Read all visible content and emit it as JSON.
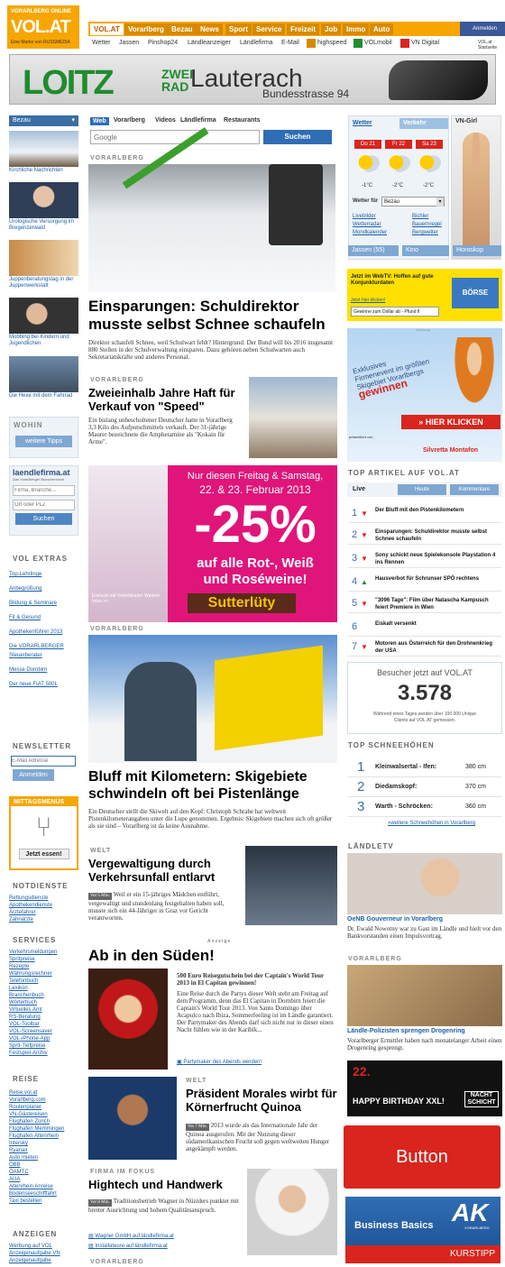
{
  "header": {
    "logo_top": "VORARLBERG ONLINE",
    "logo_main": "VOL.AT",
    "logo_sub": "Eine Marke von RUSSMEDIA",
    "tabs": [
      "VOL.AT",
      "Vorarlberg",
      "Bezau",
      "News",
      "Sport",
      "Service",
      "Freizeit",
      "Job",
      "Immo",
      "Auto"
    ],
    "facebook": "Anmelden",
    "subnav": [
      "Wetter",
      "Jassen",
      "Pinshop24",
      "Ländleanzeiger",
      "Ländlefirma",
      "E-Mail",
      "highspeed",
      "VOLmobil",
      "VN Digital",
      "VOL.at Startseite"
    ]
  },
  "banner": {
    "brand": "LOITZ",
    "brand2": "ZWEI RAD",
    "city": "Lauterach",
    "street": "Bundesstrasse 94"
  },
  "left": {
    "region_select": "Bezau",
    "thumbs": [
      "Kirchliche Nachrichten",
      "Urologische Versorgung im Bregenzerwald",
      "Juppenberatungstag in der Juppenwerkstatt",
      "Mobbing bei Kindern und Jugendlichen",
      "Die Hexe mit dem Fahrrad"
    ],
    "wohin": {
      "title": "WOHIN",
      "button": "weitere Tipps"
    },
    "laendlefirma": {
      "title": "laendlefirma.at",
      "subtitle": "Das Vorarlberger Branchenbuch",
      "firma_ph": "Firma, Branche...",
      "ort_ph": "Ort oder PLZ",
      "button": "Suchen"
    },
    "extras_title": "VOL EXTRAS",
    "extras": [
      "Top-Lehrlinge",
      "Anbegrüßung",
      "Bildung & Seminare",
      "Fit & Gesund",
      "Apothekenführer 2013",
      "Die VORARLBERGER Steuerberater",
      "Messe Dornbirn",
      "Der neue FIAT 500L"
    ],
    "newsletter": {
      "title": "NEWSLETTER",
      "placeholder": "E-Mail Adresse",
      "button": "Anmelden"
    },
    "mittag": {
      "title": "MITTAGSMENÜS",
      "button": "Jetzt essen!"
    },
    "notdienste_title": "NOTDIENSTE",
    "notdienste": [
      "Rettungsdienste",
      "Apothekendienste",
      "Ärztefahrer",
      "Zahnärzte"
    ],
    "services_title": "SERVICES",
    "services": [
      "Verkehrsmeldungen",
      "Spritpreise",
      "Rezepte",
      "Währungsrechner",
      "Telefonbuch",
      "Lexikon",
      "Branchenbuch",
      "Wörterbuch",
      "Virtuelles Amt",
      "RS-Beratung",
      "VOL-Toolbar",
      "VOL-Screensaver",
      "VOL-iPhone-App",
      "Sprit-Tiefpreise",
      "Festspiel-Archiv"
    ],
    "reise_title": "REISE",
    "reise": [
      "Reise.vol.at",
      "Vorarlberg.com",
      "Routenplaner",
      "VN-Gästereisen",
      "Flughafen Zürich",
      "Flughafen Memmingen",
      "Flughafen Altenrhein",
      "Intersky",
      "Ryanair",
      "Auto mieten",
      "ÖBB",
      "ÖAMTC",
      "AUA",
      "Altenrhein Anreise",
      "Bodenseeschifffahrt",
      "Taxi bestellen"
    ],
    "anzeigen_title": "ANZEIGEN",
    "anzeigen": [
      "Werbung auf VOL",
      "Anzeigenaufgabe VN",
      "Anzeigenaufgabe"
    ]
  },
  "middle": {
    "search_tabs": [
      "Web",
      "Vorarlberg",
      "Videos",
      "Ländlefirma",
      "Restaurants"
    ],
    "search_placeholder": "Google",
    "search_button": "Suchen",
    "a1": {
      "kicker": "VORARLBERG",
      "title": "Einsparungen: Schuldirektor musste selbst Schnee schaufeln",
      "body": "Direktor schaufelt Schnee, weil Schulwart fehlt? Hintergrund: Der Bund will bis 2016 insgesamt 880 Stellen in der Schulverwaltung einsparen. Dazu gehören neben Schulwarten auch Sekretariatskräfte und anderes Personal."
    },
    "a2": {
      "kicker": "VORARLBERG",
      "title": "Zweieinhalb Jahre Haft für Verkauf von \"Speed\"",
      "body": "Ein bislang unbescholtener Deutscher hatte in Vorarlberg 3,3 Kilo des Aufputschmittels verkauft. Der 31-jährige Maurer bezeichnete die Amphetamine als \"Kokain für Arme\"."
    },
    "ad": {
      "line1": "Nur diesen Freitag & Samstag,",
      "line2": "22. & 23. Februar 2013",
      "pct": "-25%",
      "line3": "auf alle Rot-, Weiß",
      "line4": "und Roséweine!",
      "brand": "Sutterlüty",
      "small": "Exklusiv mit Vorteilskarte! Weitere Infos >>"
    },
    "a3": {
      "kicker": "VORARLBERG",
      "title": "Bluff mit Kilometern: Skigebiete schwindeln oft bei Pistenlänge",
      "body": "Ein Deutscher stellt die Skiwelt auf den Kopf: Christoph Schrahe hat weltweit Pistenkilometerangaben unter die Lupe genommen. Ergebnis: Skigebiete machen sich oft größer als sie sind – Vorarlberg ist da keine Ausnahme."
    },
    "a4": {
      "kicker": "WELT",
      "title": "Vergewaltigung durch Verkehrsunfall entlarvt",
      "badge": "Vor 5 Min.",
      "body": "Weil er ein 15-jähriges Mädchen entführt, vergewaltigt und stundenlang festgehalten haben soll, musste sich ein 44-Jähriger in Graz vor Gericht verantworten."
    },
    "a5": {
      "kicker": "Anzeige",
      "title": "Ab in den Süden!",
      "subtitle": "500 Euro Reisegutschein bei der Captain's World Tour 2013 in El Capitan gewinnen!",
      "body": "Eine Reise durch die Partys dieser Welt steht am Freitag auf dem Programm, denn das El Capitan in Dornbirn feiert die Captain's World Tour 2013. Von Santo Domingo über Acapulco nach Ibiza, Sommerfeeling ist im Ländle garantiert. Der Partymaker des Abends darf sich nicht nur in dieser einen Nacht fühlen wie in der Karibik...",
      "link": "Partymaker des Abends werden!"
    },
    "a6": {
      "kicker": "WELT",
      "title": "Präsident Morales wirbt für Körnerfrucht Quinoa",
      "badge": "Vor 7 Min.",
      "body": "2013 wurde als das Internationale Jahr der Quinoa ausgerufen. Mit der Nutzung dieser südamerikanischen Frucht soll gegen weltweiten Hunger angekämpft werden."
    },
    "a7": {
      "kicker": "FIRMA IM FOKUS",
      "title": "Hightech und Handwerk",
      "badge": "Vor 8 Min.",
      "body": "Traditionsbetrieb Wagner in Nüziders punktet mit breiter Ausrichtung und hohem Qualitätsanspruch.",
      "link1": "Wagner GmbH auf ländlefirma.at",
      "link2": "Installateure auf ländlefirma.at"
    },
    "bottom_kicker": "VORARLBERG"
  },
  "right": {
    "weather": {
      "tab1": "Wetter",
      "tab2": "Verkehr",
      "days": [
        "Do 21",
        "Fr 22",
        "Sa 23"
      ],
      "temps": [
        "-1°C",
        "-2°C",
        "-2°C"
      ],
      "for_label": "Wetter für",
      "place": "Bezau",
      "links": [
        "Livebilder",
        "Wetterradar",
        "Mondkalender",
        "Bichler",
        "Bauernregel",
        "Bergwetter"
      ],
      "btns": [
        "Jassen (55)",
        "Kino",
        "Horoskop"
      ]
    },
    "vngirl": "VN-Girl",
    "webtv": {
      "title": "Jetzt im WebTV: Hoffen auf gute Konjunkturdaten",
      "link": "Jetzt hier klicken!",
      "ticker": "Gewinne zum Dollar ab - Pfund fi",
      "logo": "BÖRSE"
    },
    "ad2": {
      "label": "Werbung",
      "text1": "Exklusives",
      "text2": "Firmenevent im größten",
      "text3": "Skigebiet Vorarlbergs",
      "text4": "gewinnen",
      "btn": "» HIER KLICKEN",
      "brand": "Silvretta Montafon",
      "presented": "präsentiert von"
    },
    "top": {
      "title": "TOP ARTIKEL AUF VOL.AT",
      "tab1": "Live",
      "tab2": "Heute",
      "tab3": "Kommentare",
      "items": [
        "Der Bluff mit den Pistenkilometern",
        "Einsparungen: Schuldirektor musste selbst Schnee schaufeln",
        "Sony schickt neue Spielekonsole Playstation 4 ins Rennen",
        "Hausverbot für Schrunser SPÖ rechtens",
        "\"3096 Tage\": Film über Natascha Kampusch feiert Premiere in Wien",
        "Eiskalt versenkt",
        "Motoren aus Österreich für den Drohnenkrieg der USA"
      ]
    },
    "visitors": {
      "label": "Besucher jetzt auf VOL.AT",
      "count": "3.578",
      "note": "Während eines Tages werden über 100.000 Unique Clients auf VOL.AT gemessen."
    },
    "snow": {
      "title": "TOP SCHNEEHÖHEN",
      "rows": [
        {
          "n": "1",
          "name": "Kleinwalsertal - Ifen:",
          "cm": "380 cm"
        },
        {
          "n": "2",
          "name": "Diedamskopf:",
          "cm": "370 cm"
        },
        {
          "n": "3",
          "name": "Warth - Schröcken:",
          "cm": "360 cm"
        }
      ],
      "more": "»weitere Schneehöhen in Vorarlberg"
    },
    "ltv": {
      "title": "LÄNDLETV",
      "headline": "OeNB Gouverneur in Vorarlberg",
      "body": "Dr. Ewald Nowotny war zu Gast im Ländle und hielt vor den Bankvorstanden einen Impulsvortrag."
    },
    "vbg": {
      "kicker": "VORARLBERG",
      "headline": "Ländle-Polizisten sprengen Drogenring",
      "body": "Vorarlberger Ermittler haben nach monatelanger Arbeit einen Drogenring gesprengt."
    },
    "bday": {
      "date": "22.",
      "text": "HAPPY BIRTHDAY XXL!",
      "brand": "NACHT SCHICHT"
    },
    "button": "Button",
    "ak": {
      "logo": "AK",
      "sub": "VORARLBERG",
      "text": "Business Basics",
      "tag": "KURSTIPP"
    }
  }
}
